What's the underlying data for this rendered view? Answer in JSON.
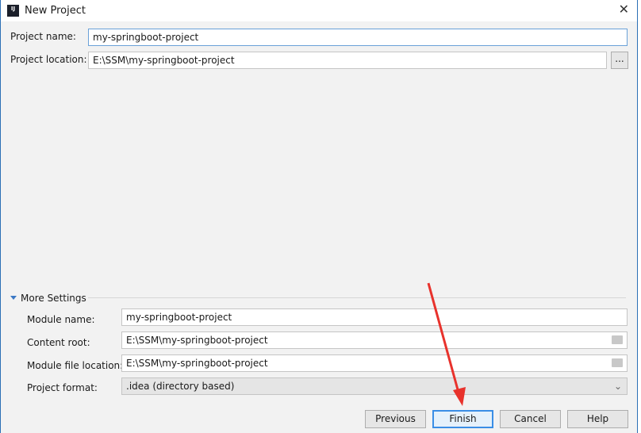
{
  "window": {
    "title": "New Project",
    "app_icon": "intellij-idea-icon",
    "close_icon": "close-icon"
  },
  "project": {
    "name_label": "Project name:",
    "name_value": "my-springboot-project",
    "location_label": "Project location:",
    "location_value": "E:\\SSM\\my-springboot-project",
    "browse_label": "..."
  },
  "more_settings": {
    "label": "More Settings",
    "expanded": true,
    "module_name_label": "Module name:",
    "module_name_value": "my-springboot-project",
    "content_root_label": "Content root:",
    "content_root_value": "E:\\SSM\\my-springboot-project",
    "module_file_label": "Module file location:",
    "module_file_value": "E:\\SSM\\my-springboot-project",
    "format_label": "Project format:",
    "format_value": ".idea (directory based)"
  },
  "buttons": {
    "previous": "Previous",
    "finish": "Finish",
    "cancel": "Cancel",
    "help": "Help"
  },
  "annotation": {
    "arrow": "red-arrow-icon",
    "color": "#e8322c"
  }
}
